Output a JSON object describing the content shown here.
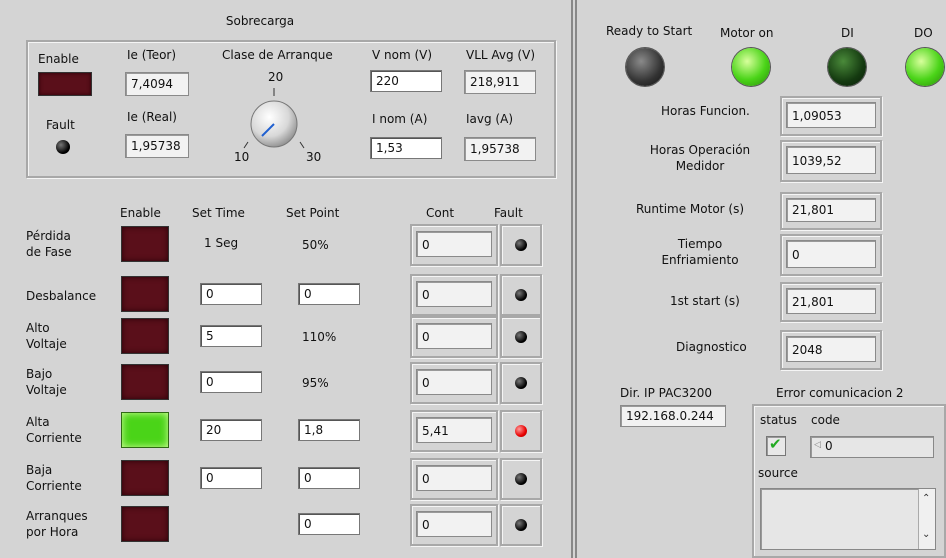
{
  "sobrecarga": {
    "title": "Sobrecarga",
    "enable_label": "Enable",
    "fault_label": "Fault",
    "ie_teor_label": "Ie (Teor)",
    "ie_teor_value": "7,4094",
    "ie_real_label": "Ie (Real)",
    "ie_real_value": "1,95738",
    "clase_label": "Clase de Arranque",
    "knob_min": "10",
    "knob_mid": "20",
    "knob_max": "30",
    "vnom_label": "V nom (V)",
    "vnom_value": "220",
    "vll_label": "VLL Avg (V)",
    "vll_value": "218,911",
    "inom_label": "I nom (A)",
    "inom_value": "1,53",
    "iavg_label": "Iavg (A)",
    "iavg_value": "1,95738"
  },
  "protections": {
    "headers": {
      "enable": "Enable",
      "set_time": "Set Time",
      "set_point": "Set Point",
      "cont": "Cont",
      "fault": "Fault"
    },
    "rows": [
      {
        "label_1": "Pérdida",
        "label_2": "de Fase",
        "enabled": false,
        "set_time": "1 Seg",
        "set_time_input": false,
        "set_point": "50%",
        "set_point_input": false,
        "cont": "0",
        "fault": false
      },
      {
        "label_1": "Desbalance",
        "label_2": "",
        "enabled": false,
        "set_time": "0",
        "set_time_input": true,
        "set_point": "0",
        "set_point_input": true,
        "cont": "0",
        "fault": false
      },
      {
        "label_1": "Alto",
        "label_2": "Voltaje",
        "enabled": false,
        "set_time": "5",
        "set_time_input": true,
        "set_point": "110%",
        "set_point_input": false,
        "cont": "0",
        "fault": false
      },
      {
        "label_1": "Bajo",
        "label_2": "Voltaje",
        "enabled": false,
        "set_time": "0",
        "set_time_input": true,
        "set_point": "95%",
        "set_point_input": false,
        "cont": "0",
        "fault": false
      },
      {
        "label_1": "Alta",
        "label_2": "Corriente",
        "enabled": true,
        "set_time": "20",
        "set_time_input": true,
        "set_point": "1,8",
        "set_point_input": true,
        "cont": "5,41",
        "fault": true
      },
      {
        "label_1": "Baja",
        "label_2": "Corriente",
        "enabled": false,
        "set_time": "0",
        "set_time_input": true,
        "set_point": "0",
        "set_point_input": true,
        "cont": "0",
        "fault": false
      },
      {
        "label_1": "Arranques",
        "label_2": "por Hora",
        "enabled": false,
        "set_time": "",
        "set_time_input": false,
        "set_point": "0",
        "set_point_input": true,
        "cont": "0",
        "fault": false
      }
    ]
  },
  "status_lights": {
    "ready_label": "Ready to Start",
    "motor_label": "Motor on",
    "di_label": "DI",
    "do_label": "DO",
    "ready_on": false,
    "motor_on": true,
    "di_on": false,
    "do_on": true
  },
  "metrics": {
    "horas_func_label": "Horas Funcion.",
    "horas_func_value": "1,09053",
    "horas_op_label_1": "Horas Operación",
    "horas_op_label_2": "Medidor",
    "horas_op_value": "1039,52",
    "runtime_label": "Runtime Motor (s)",
    "runtime_value": "21,801",
    "tiempo_label_1": "Tiempo",
    "tiempo_label_2": "Enfriamiento",
    "tiempo_value": "0",
    "first_start_label": "1st start (s)",
    "first_start_value": "21,801",
    "diag_label": "Diagnostico",
    "diag_value": "2048"
  },
  "network": {
    "ip_label": "Dir. IP PAC3200",
    "ip_value": "192.168.0.244",
    "error_title": "Error comunicacion 2",
    "status_label": "status",
    "code_label": "code",
    "code_value": "0",
    "source_label": "source",
    "source_value": ""
  },
  "colors": {
    "led_off_dark": "#5a0f1a",
    "led_on_green": "#4ad418",
    "fault_red": "#e80000",
    "panel_bg": "#d4d4d4"
  }
}
